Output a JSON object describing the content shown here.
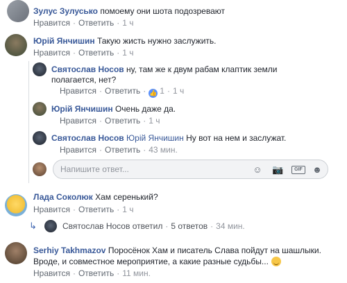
{
  "comments": [
    {
      "author": "Зулус Зулусько",
      "text": "помоему они шота подозревают",
      "actions": {
        "like": "Нравится",
        "reply": "Ответить",
        "time": "1 ч"
      },
      "avatar_color": "#8a8f97"
    },
    {
      "author": "Юрій Янчишин",
      "text": "Такую жисть нужно заслужить.",
      "actions": {
        "like": "Нравится",
        "reply": "Ответить",
        "time": "1 ч"
      },
      "avatar_color": "#5b6b4e",
      "replies": [
        {
          "author": "Святослав Носов",
          "text_line1": "ну, там же к двум рабам клаптик земли",
          "text_line2": "полагается, нет?",
          "actions": {
            "like": "Нравится",
            "reply": "Ответить",
            "likes_count": "1",
            "time": "1 ч"
          },
          "avatar_color": "#2c3442"
        },
        {
          "author": "Юрій Янчишин",
          "text": "Очень даже да.",
          "actions": {
            "like": "Нравится",
            "reply": "Ответить",
            "time": "1 ч"
          },
          "avatar_color": "#5b6b4e"
        },
        {
          "author": "Святослав Носов",
          "mention": "Юрій Янчишин",
          "text": "Ну вот на нем и заслужат.",
          "actions": {
            "like": "Нравится",
            "reply": "Ответить",
            "time": "43 мин."
          },
          "avatar_color": "#2c3442"
        }
      ],
      "reply_input": {
        "placeholder": "Напишите ответ...",
        "avatar_color": "#8a6a4a",
        "icons": [
          "emoji-icon",
          "camera-icon",
          "gif-icon",
          "sticker-icon"
        ],
        "gif_label": "GIF"
      }
    },
    {
      "author": "Лада Соколюк",
      "text": "Хам серенький?",
      "actions": {
        "like": "Нравится",
        "reply": "Ответить",
        "time": "1 ч"
      },
      "avatar_color": "#f3c23b",
      "replies_summary": {
        "author": "Святослав Носов",
        "verb": "ответил",
        "count": "5 ответов",
        "time": "34 мин."
      }
    },
    {
      "author": "Serhiy Takhmazov",
      "text_line1": "Поросёнок Хам и писатель Слава пойдут на шашлыки.",
      "text_line2": "Вроде, и совместное мероприятие, а какие разные судьбы...",
      "actions": {
        "like": "Нравится",
        "reply": "Ответить",
        "time": "11 мин."
      },
      "avatar_color": "#6b5a48"
    }
  ],
  "separator": "·"
}
